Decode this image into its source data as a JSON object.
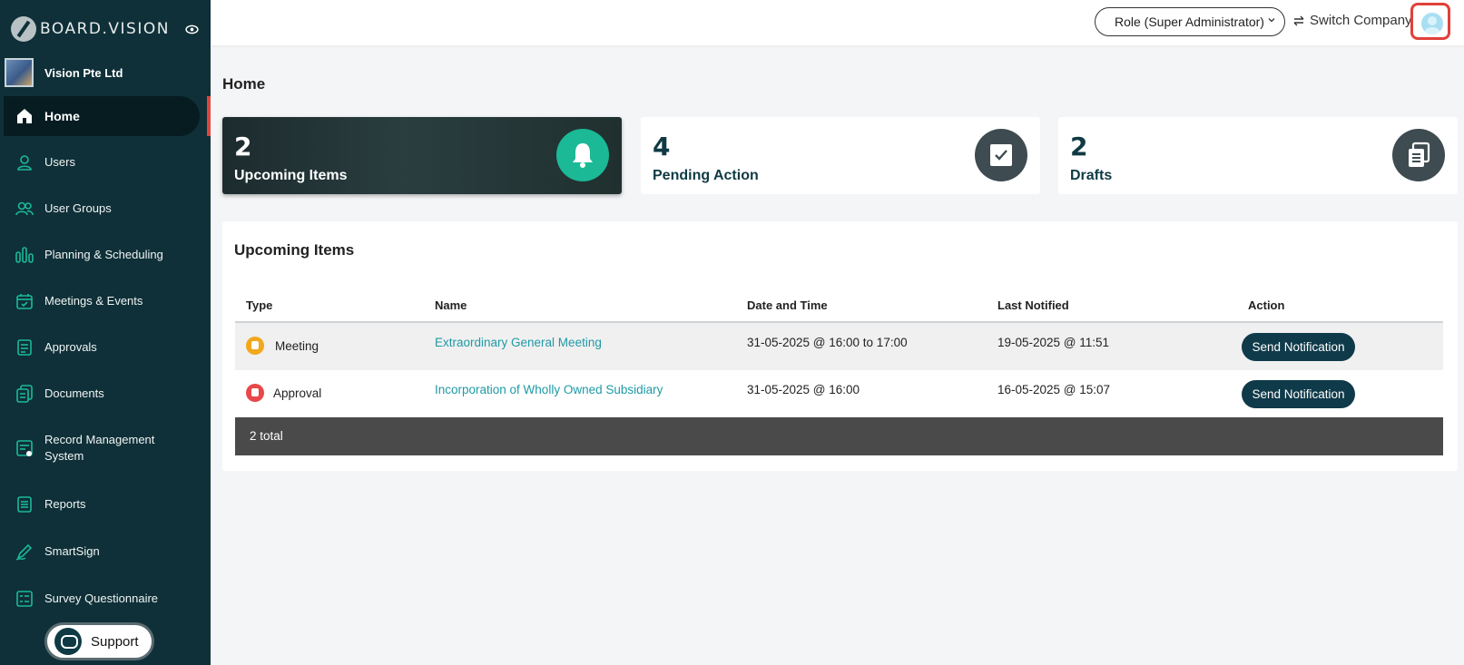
{
  "brand": {
    "name": "BOARD.VISION"
  },
  "company": {
    "name": "Vision Pte Ltd"
  },
  "sidebar": {
    "items": [
      {
        "label": "Home",
        "icon": "home-icon"
      },
      {
        "label": "Users",
        "icon": "user-icon"
      },
      {
        "label": "User Groups",
        "icon": "user-groups-icon"
      },
      {
        "label": "Planning & Scheduling",
        "icon": "chart-bars-icon"
      },
      {
        "label": "Meetings & Events",
        "icon": "calendar-icon"
      },
      {
        "label": "Approvals",
        "icon": "approval-doc-icon"
      },
      {
        "label": "Documents",
        "icon": "documents-icon"
      },
      {
        "label": "Record Management System",
        "icon": "record-icon"
      },
      {
        "label": "Reports",
        "icon": "reports-icon"
      },
      {
        "label": "SmartSign",
        "icon": "pen-icon"
      },
      {
        "label": "Survey Questionnaire",
        "icon": "survey-icon"
      }
    ],
    "support_label": "Support"
  },
  "topbar": {
    "role": "Role (Super Administrator)",
    "switch_company": "Switch Company"
  },
  "page": {
    "title": "Home"
  },
  "stats": [
    {
      "value": "2",
      "label": "Upcoming Items",
      "icon": "bell-icon"
    },
    {
      "value": "4",
      "label": "Pending Action",
      "icon": "checkbox-icon"
    },
    {
      "value": "2",
      "label": "Drafts",
      "icon": "drafts-icon"
    }
  ],
  "upcoming": {
    "title": "Upcoming Items",
    "columns": [
      "Type",
      "Name",
      "Date and Time",
      "Last Notified",
      "Action"
    ],
    "rows": [
      {
        "type": "Meeting",
        "name": "Extraordinary General Meeting",
        "datetime": "31-05-2025 @ 16:00 to 17:00",
        "last_notified": "19-05-2025 @ 11:51",
        "action": "Send Notification"
      },
      {
        "type": "Approval",
        "name": "Incorporation of Wholly Owned Subsidiary",
        "datetime": "31-05-2025 @ 16:00",
        "last_notified": "16-05-2025 @ 15:07",
        "action": "Send Notification"
      }
    ],
    "total": "2 total"
  },
  "colors": {
    "sidebar": "#0f3038",
    "accent": "#1bb996",
    "button": "#0f3a4a",
    "link": "#1f9aa6",
    "highlight": "#e0413a"
  }
}
